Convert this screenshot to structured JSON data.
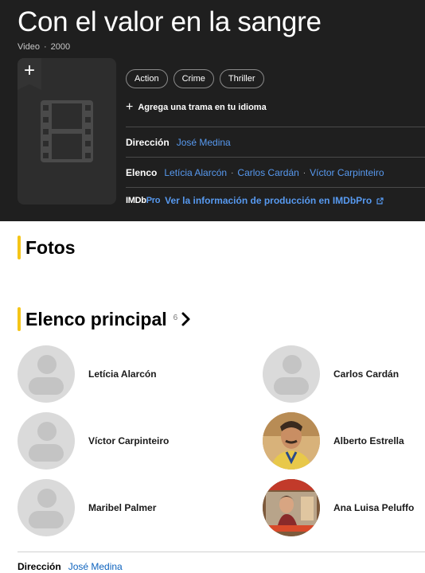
{
  "title": "Con el valor en la sangre",
  "meta": {
    "type": "Video",
    "year": "2000"
  },
  "poster": {
    "add_symbol": "+"
  },
  "genres": [
    "Action",
    "Crime",
    "Thriller"
  ],
  "plot_prompt": "Agrega una trama en tu idioma",
  "director_label": "Dirección",
  "director": "José Medina",
  "cast_label": "Elenco",
  "cast_links": [
    "Letícia Alarcón",
    "Carlos Cardán",
    "Víctor Carpinteiro"
  ],
  "imdbpro": {
    "logo_a": "IMDb",
    "logo_b": "Pro",
    "link_text": "Ver la información de producción en IMDbPro"
  },
  "photos_title": "Fotos",
  "main_cast": {
    "title": "Elenco principal",
    "count": "6",
    "members": [
      "Letícia Alarcón",
      "Carlos Cardán",
      "Víctor Carpinteiro",
      "Alberto Estrella",
      "Maribel Palmer",
      "Ana Luisa Peluffo"
    ]
  },
  "colors": {
    "accent": "#f5c518",
    "link_dark": "#5799ef",
    "link_light": "#0e63be",
    "hero_bg": "#1f1f1f"
  },
  "icons": [
    "plus-icon",
    "film-placeholder-icon",
    "chevron-right-icon",
    "external-link-icon",
    "person-placeholder-icon"
  ]
}
